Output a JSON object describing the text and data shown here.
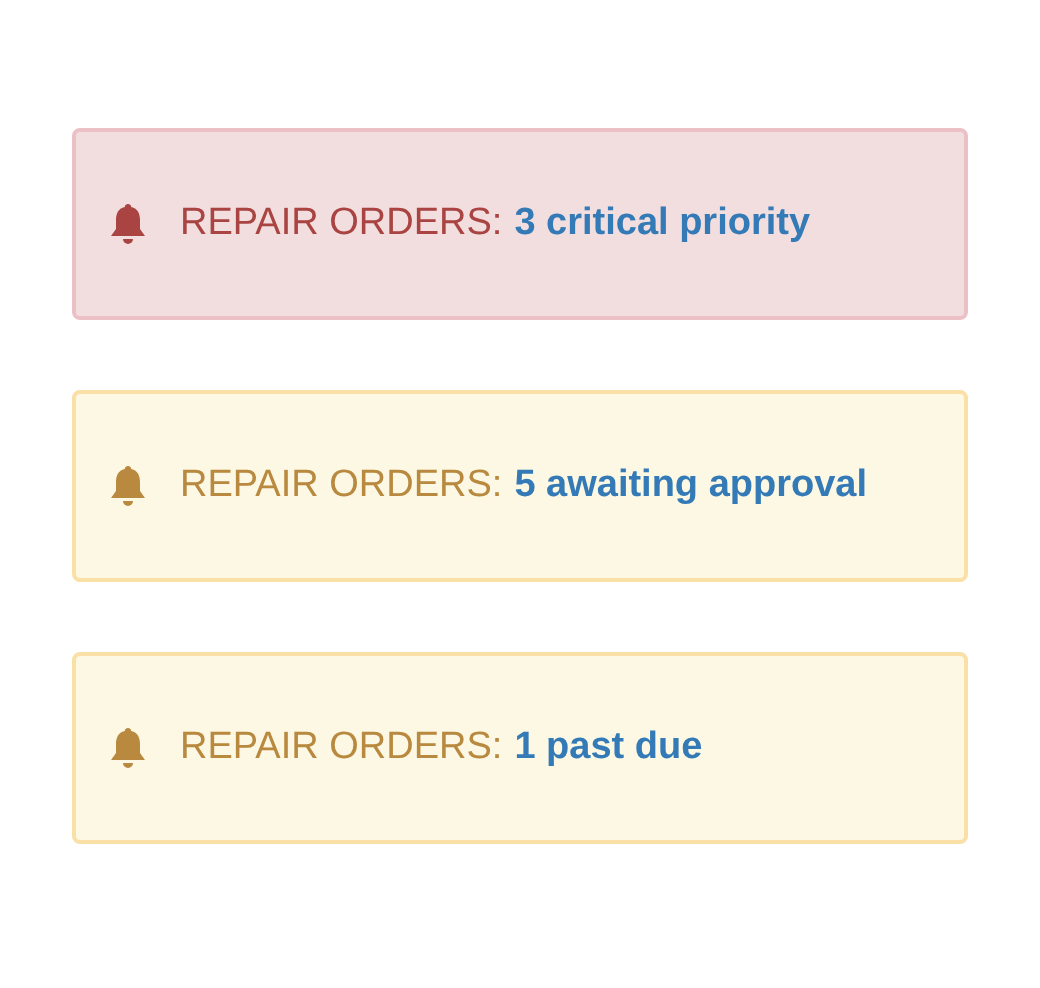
{
  "alerts": [
    {
      "kind": "danger",
      "label": "REPAIR ORDERS:",
      "link": "3 critical priority"
    },
    {
      "kind": "warning",
      "label": "REPAIR ORDERS:",
      "link": "5 awaiting approval"
    },
    {
      "kind": "warning",
      "label": "REPAIR ORDERS:",
      "link": "1 past due"
    }
  ]
}
